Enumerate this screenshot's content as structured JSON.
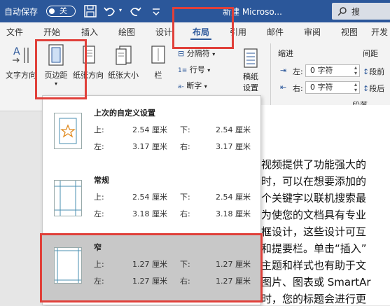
{
  "titlebar": {
    "autosave_label": "自动保存",
    "toggle_label": "关",
    "doc_title": "新建 Microso...",
    "search_placeholder": "搜"
  },
  "tabs": [
    "文件",
    "开始",
    "插入",
    "绘图",
    "设计",
    "布局",
    "引用",
    "邮件",
    "审阅",
    "视图",
    "开发"
  ],
  "active_tab": "布局",
  "ribbon": {
    "text_direction": "文字方向",
    "margins": "页边距",
    "orientation": "纸张方向",
    "size": "纸张大小",
    "columns": "栏",
    "breaks": "分隔符",
    "line_numbers": "行号",
    "hyphenation": "断字",
    "manuscript": "稿纸",
    "manuscript2": "设置",
    "indent_title": "缩进",
    "indent_left_label": "左:",
    "indent_left_value": "0 字符",
    "indent_right_label": "右:",
    "indent_right_value": "0 字符",
    "spacing_title": "间距",
    "spacing_before": "段前",
    "spacing_after": "段后",
    "paragraph_group": "段落"
  },
  "margins_menu": {
    "options": [
      {
        "name": "上次的自定义设置",
        "top_label": "上:",
        "top": "2.54 厘米",
        "bottom_label": "下:",
        "bottom": "2.54 厘米",
        "left_label": "左:",
        "left": "3.17 厘米",
        "right_label": "右:",
        "right": "3.17 厘米"
      },
      {
        "name": "常规",
        "top_label": "上:",
        "top": "2.54 厘米",
        "bottom_label": "下:",
        "bottom": "2.54 厘米",
        "left_label": "左:",
        "left": "3.18 厘米",
        "right_label": "右:",
        "right": "3.18 厘米"
      },
      {
        "name": "窄",
        "top_label": "上:",
        "top": "1.27 厘米",
        "bottom_label": "下:",
        "bottom": "1.27 厘米",
        "left_label": "左:",
        "left": "1.27 厘米",
        "right_label": "右:",
        "right": "1.27 厘米"
      }
    ],
    "selected": "窄"
  },
  "document": {
    "lines": [
      "视频提供了功能强大的",
      "时，可以在想要添加的",
      "个关键字以联机搜索最",
      "为使您的文档具有专业",
      "框设计，这些设计可互",
      "和提要栏。单击“插入”",
      "主题和样式也有助于文",
      "图片、图表或 SmartAr",
      "时，您的标题会进行更"
    ]
  },
  "colors": {
    "brand": "#2b579a",
    "highlight": "#e0403a",
    "selected_bg": "#c8c8c8"
  },
  "icons": [
    "save-icon",
    "undo-icon",
    "redo-icon",
    "customize-icon",
    "search-icon",
    "star-icon"
  ]
}
